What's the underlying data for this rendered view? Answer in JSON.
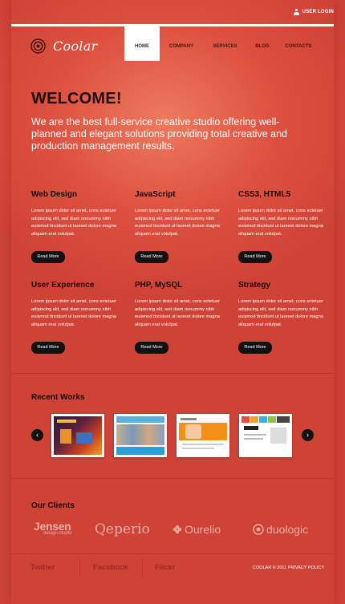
{
  "header": {
    "login_label": "USER LOGIN",
    "logo_text": "Coolar",
    "nav": [
      {
        "label": "HOME",
        "active": true
      },
      {
        "label": "COMPANY"
      },
      {
        "label": "SERVICES"
      },
      {
        "label": "BLOG"
      },
      {
        "label": "CONTACTS"
      }
    ]
  },
  "hero": {
    "title": "WELCOME!",
    "intro": "We are the best full-service creative studio offering well-planned and elegant solutions providing total creative and production management results."
  },
  "features": [
    {
      "title": "Web Design",
      "text": "Lorem ipsum dolor sit amet, cons ectetuer adipiscing elit, sed diam nonummy nibh euismod tincidunt ut laoreet dolore magna aliquam erat volutpat.",
      "button": "Read More"
    },
    {
      "title": "JavaScript",
      "text": "Lorem ipsum dolor sit amet, cons ectetuer adipiscing elit, sed diam nonummy nibh euismod tincidunt ut laoreet dolore magna aliquam erat volutpat.",
      "button": "Read More"
    },
    {
      "title": "CSS3, HTML5",
      "text": "Lorem ipsum dolor sit amet, cons ectetuer adipiscing elit, sed diam nonummy nibh euismod tincidunt ut laoreet dolore magna aliquam erat volutpat.",
      "button": "Read More"
    },
    {
      "title": "User Experience",
      "text": "Lorem ipsum dolor sit amet, cons ectetuer adipiscing elit, sed diam nonummy nibh euismod tincidunt ut laoreet dolore magna aliquam erat volutpat.",
      "button": "Read More"
    },
    {
      "title": "PHP, MySQL",
      "text": "Lorem ipsum dolor sit amet, cons ectetuer adipiscing elit, sed diam nonummy nibh euismod tincidunt ut laoreet dolore magna aliquam erat volutpat.",
      "button": "Read More"
    },
    {
      "title": "Strategy",
      "text": "Lorem ipsum dolor sit amet, cons ectetuer adipiscing elit, sed diam nonummy nibh euismod tincidunt ut laoreet dolore magna aliquam erat volutpat.",
      "button": "Read More"
    }
  ],
  "recent_works": {
    "title": "Recent Works",
    "prev_icon": "chevron-left-icon",
    "next_icon": "chevron-right-icon"
  },
  "clients": {
    "title": "Our Clients",
    "logos": [
      {
        "name": "Jensen",
        "tagline": "design studio"
      },
      {
        "name": "Qeperio"
      },
      {
        "name": "Ourelio"
      },
      {
        "name": "duologic"
      }
    ]
  },
  "footer": {
    "links": [
      "Twitter",
      "Facebook",
      "Flickr"
    ],
    "copyright": "COOLAR © 2011 PRIVACY POLICY"
  },
  "colors": {
    "background": "#dd503f",
    "highlight": "#ee7a5e",
    "heading": "#1a0a08",
    "button": "#111111"
  }
}
